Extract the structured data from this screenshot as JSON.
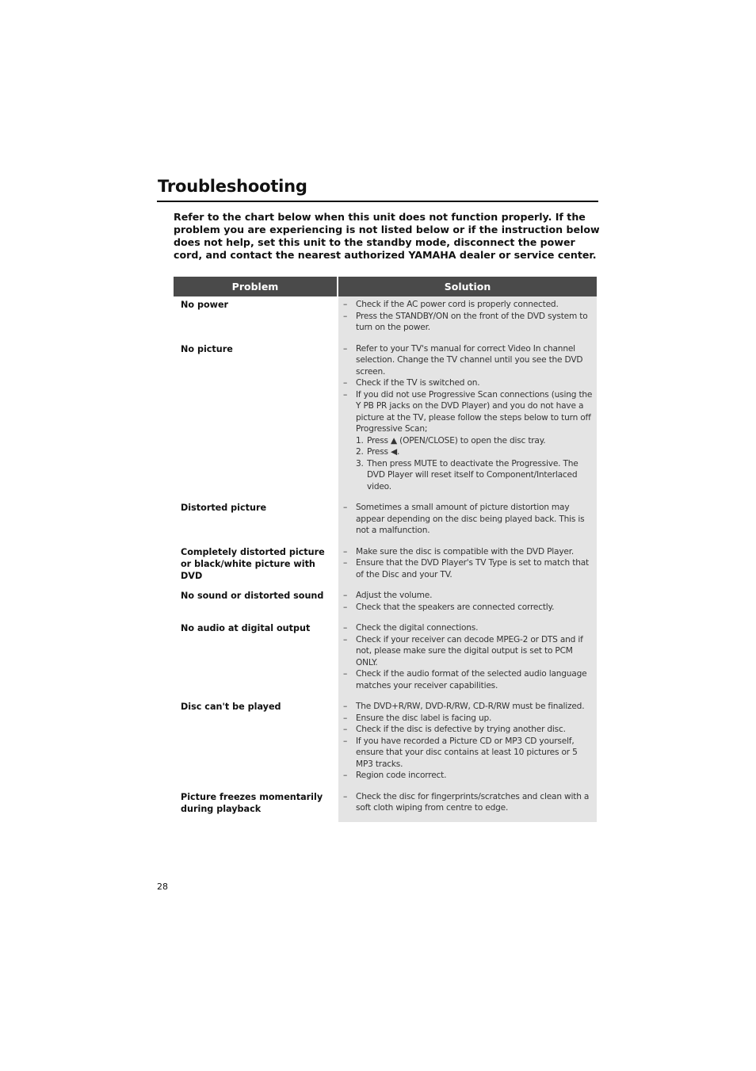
{
  "page": {
    "title": "Troubleshooting",
    "intro": "Refer to the chart below when this unit does not function properly. If the problem you are experiencing is not listed below or if the instruction below does not help, set this unit to the standby mode, disconnect the power cord, and contact the nearest authorized YAMAHA dealer or service center.",
    "page_number": "28"
  },
  "table": {
    "headers": {
      "problem": "Problem",
      "solution": "Solution"
    },
    "rows": [
      {
        "problem": "No power",
        "solutions": [
          "Check if the AC power cord is properly connected.",
          "Press the STANDBY/ON on the front of the DVD system to turn on the power."
        ]
      },
      {
        "problem": "No picture",
        "solutions": [
          "Refer to your TV's manual for correct Video In channel selection. Change the TV channel until you see the DVD screen.",
          "Check if the TV is switched on.",
          "If you did not use Progressive Scan connections (using the Y PB PR jacks on the DVD Player) and you do not have a picture at the TV, please follow the steps below to turn off Progressive Scan;"
        ],
        "steps": [
          "Press ▲ (OPEN/CLOSE) to open the disc tray.",
          "Press ◀.",
          "Then press MUTE to deactivate the Progressive. The DVD Player will reset itself to Component/Interlaced video."
        ]
      },
      {
        "problem": "Distorted picture",
        "solutions": [
          "Sometimes a small amount of picture distortion may appear depending on the disc being played back. This is not a malfunction."
        ]
      },
      {
        "problem": "Completely distorted picture or black/white picture with DVD",
        "solutions": [
          "Make sure the disc is compatible with the DVD Player.",
          "Ensure that the DVD Player's TV Type is set to match that of the Disc and your TV."
        ]
      },
      {
        "problem": "No sound or distorted sound",
        "solutions": [
          "Adjust the volume.",
          "Check that the speakers are connected correctly."
        ]
      },
      {
        "problem": "No audio at digital output",
        "solutions": [
          "Check the digital connections.",
          "Check if your receiver can decode MPEG-2 or DTS and if not, please make sure the digital output is set to PCM ONLY.",
          "Check if the audio format of the selected audio language matches your receiver capabilities."
        ]
      },
      {
        "problem": "Disc can't be played",
        "solutions": [
          "The DVD+R/RW, DVD-R/RW, CD-R/RW must be finalized.",
          "Ensure the disc label is facing up.",
          "Check if the disc is defective by trying another disc.",
          "If you have recorded a Picture CD or MP3 CD yourself, ensure that your disc contains at least 10 pictures or 5 MP3 tracks.",
          "Region code incorrect."
        ]
      },
      {
        "problem": "Picture freezes momentarily during playback",
        "solutions": [
          "Check the disc for fingerprints/scratches and clean with a soft cloth wiping from centre to edge."
        ]
      }
    ]
  }
}
